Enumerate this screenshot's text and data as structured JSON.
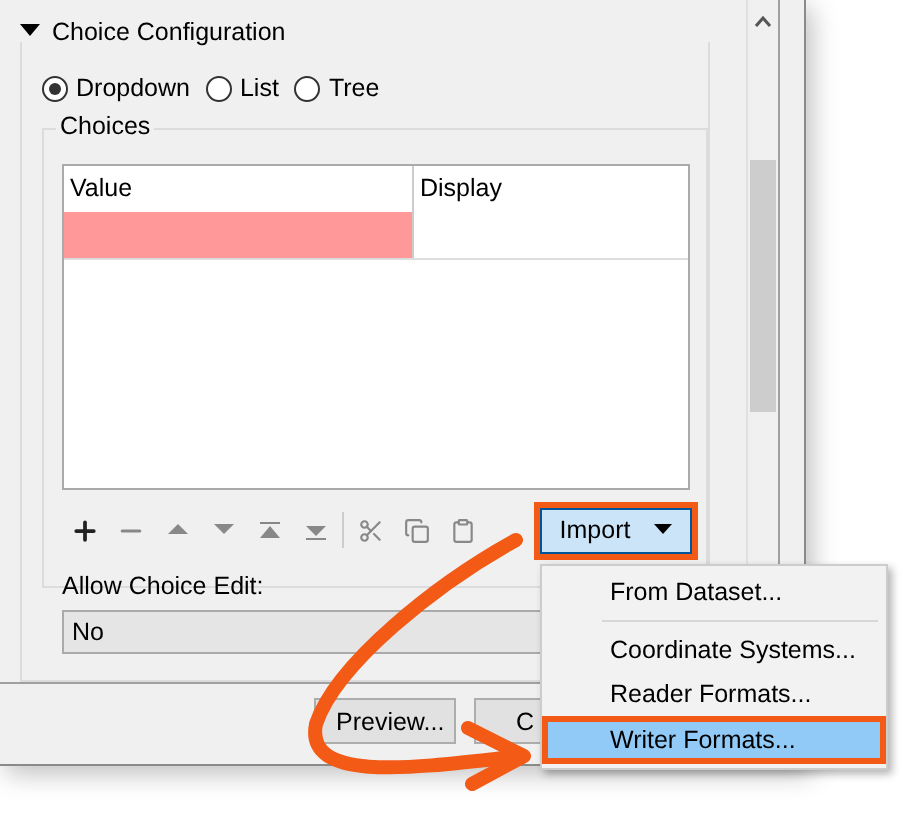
{
  "section": {
    "title": "Choice Configuration",
    "expanded": true
  },
  "modes": [
    {
      "label": "Dropdown",
      "selected": true
    },
    {
      "label": "List",
      "selected": false
    },
    {
      "label": "Tree",
      "selected": false
    }
  ],
  "choices": {
    "title": "Choices",
    "columns": [
      "Value",
      "Display"
    ],
    "rows": [
      {
        "error": true
      }
    ]
  },
  "import_button": {
    "label": "Import",
    "highlighted": true
  },
  "allow_choice_edit": {
    "label": "Allow Choice Edit:",
    "value": "No"
  },
  "buttons": [
    "Preview...",
    "C"
  ],
  "import_menu": [
    {
      "kind": "item",
      "label": "From Dataset...",
      "selected": false
    },
    {
      "kind": "separator"
    },
    {
      "kind": "item",
      "label": "Coordinate Systems...",
      "selected": false
    },
    {
      "kind": "item",
      "label": "Reader Formats...",
      "selected": false
    },
    {
      "kind": "item",
      "label": "Writer Formats...",
      "selected": true
    }
  ]
}
